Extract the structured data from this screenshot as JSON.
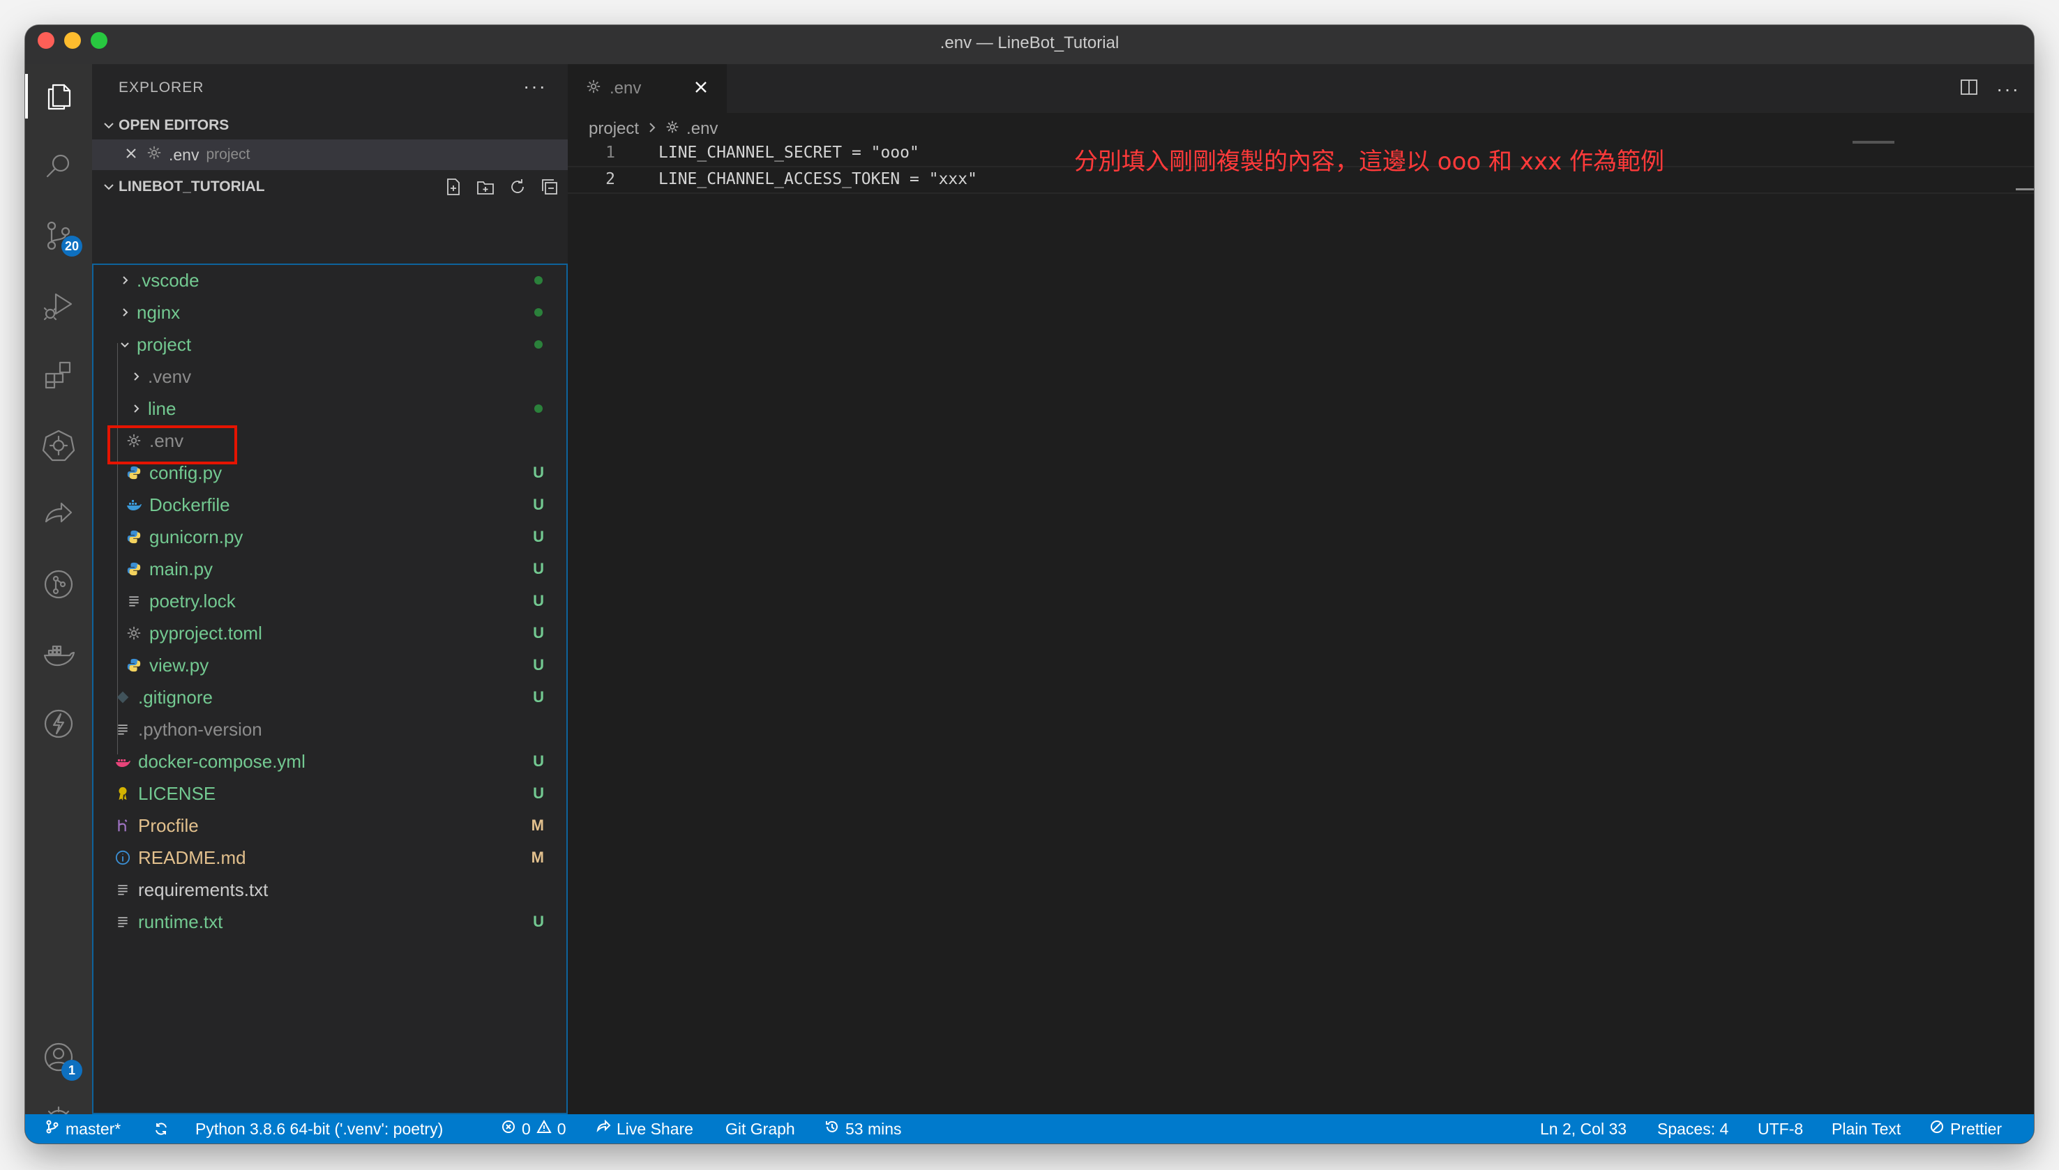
{
  "window": {
    "title": ".env — LineBot_Tutorial"
  },
  "activity": {
    "source_control_badge": "20",
    "accounts_badge": "1"
  },
  "sidebar": {
    "title": "EXPLORER",
    "more": "···",
    "open_editors_label": "OPEN EDITORS",
    "open_editor": {
      "name": ".env",
      "path": "project"
    },
    "workspace_label": "LINEBOT_TUTORIAL",
    "tree": [
      {
        "name": ".vscode",
        "status": "",
        "indicator": "dot"
      },
      {
        "name": "nginx",
        "status": "",
        "indicator": "dot"
      },
      {
        "name": "project",
        "status": "",
        "indicator": "dot"
      },
      {
        "name": ".venv",
        "status": ""
      },
      {
        "name": "line",
        "status": "",
        "indicator": "dot"
      },
      {
        "name": ".env",
        "status": ""
      },
      {
        "name": "config.py",
        "status": "U"
      },
      {
        "name": "Dockerfile",
        "status": "U"
      },
      {
        "name": "gunicorn.py",
        "status": "U"
      },
      {
        "name": "main.py",
        "status": "U"
      },
      {
        "name": "poetry.lock",
        "status": "U"
      },
      {
        "name": "pyproject.toml",
        "status": "U"
      },
      {
        "name": "view.py",
        "status": "U"
      },
      {
        "name": ".gitignore",
        "status": "U"
      },
      {
        "name": ".python-version",
        "status": ""
      },
      {
        "name": "docker-compose.yml",
        "status": "U"
      },
      {
        "name": "LICENSE",
        "status": "U"
      },
      {
        "name": "Procfile",
        "status": "M"
      },
      {
        "name": "README.md",
        "status": "M"
      },
      {
        "name": "requirements.txt",
        "status": ""
      },
      {
        "name": "runtime.txt",
        "status": "U"
      }
    ]
  },
  "editor": {
    "tab": {
      "label": ".env"
    },
    "breadcrumb": {
      "folder": "project",
      "file": ".env"
    },
    "lines": [
      {
        "number": "1",
        "text": "LINE_CHANNEL_SECRET = \"ooo\""
      },
      {
        "number": "2",
        "text": "LINE_CHANNEL_ACCESS_TOKEN = \"xxx\""
      }
    ],
    "annotation": "分別填入剛剛複製的內容，這邊以 ooo 和 xxx 作為範例"
  },
  "statusbar": {
    "branch": "master*",
    "python": "Python 3.8.6 64-bit ('.venv': poetry)",
    "errors": "0",
    "warnings": "0",
    "live_share": "Live Share",
    "git_graph": "Git Graph",
    "time": "53 mins",
    "cursor": "Ln 2, Col 33",
    "spaces": "Spaces: 4",
    "encoding": "UTF-8",
    "language": "Plain Text",
    "prettier": "Prettier"
  },
  "colors": {
    "statusbar_bg": "#007acc",
    "untracked": "#73c991",
    "modified": "#e2c08d",
    "annotation": "#ff3a3a",
    "highlight_box": "#e51400"
  }
}
